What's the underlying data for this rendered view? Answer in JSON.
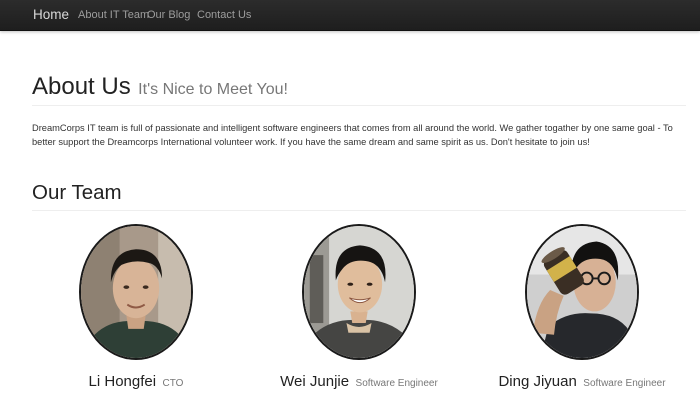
{
  "navbar": {
    "brand": "Home",
    "links": [
      "About IT Team",
      "Our Blog",
      "Contact Us"
    ]
  },
  "about": {
    "title": "About Us",
    "subtitle": "It's Nice to Meet You!",
    "description": "DreamCorps IT team is full of passionate and intelligent software engineers that comes from all around the world. We gather togather by one same goal - To better support the Dreamcorps International volunteer work. If you have the same dream and same spirit as us. Don't hesitate to join us!"
  },
  "team": {
    "title": "Our Team",
    "members": [
      {
        "name": "Li Hongfei",
        "role": "CTO"
      },
      {
        "name": "Wei Junjie",
        "role": "Software Engineer"
      },
      {
        "name": "Ding Jiyuan",
        "role": "Software Engineer"
      }
    ]
  }
}
